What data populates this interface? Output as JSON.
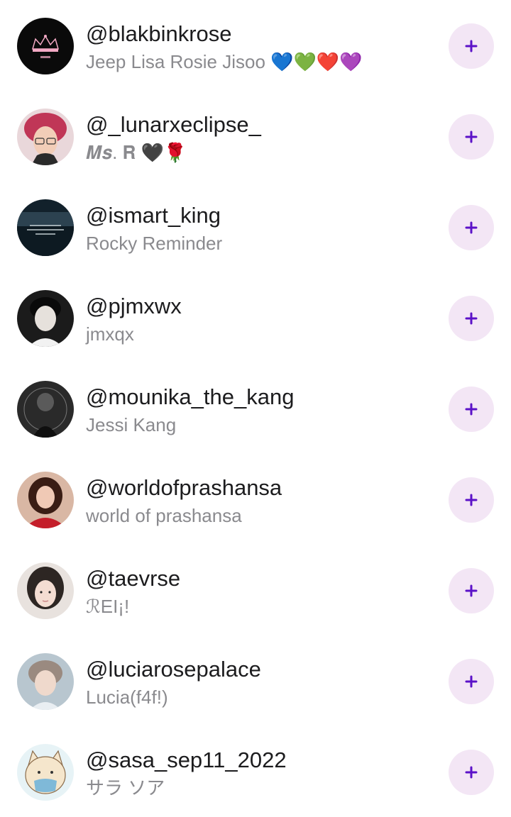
{
  "follow_icon": "plus-icon",
  "colors": {
    "accent": "#5b12c8",
    "follow_bg": "#f3e6f5",
    "handle": "#1c1c1e",
    "bio": "#8a8a8e"
  },
  "suggestions": [
    {
      "handle": "@blakbinkrose",
      "bio": "Jeep Lisa Rosie Jisoo 💙💚❤️💜"
    },
    {
      "handle": "@_lunarxeclipse_",
      "bio": "𝑴𝒔. 𝐑 🖤🌹"
    },
    {
      "handle": "@ismart_king",
      "bio": "Rocky Reminder"
    },
    {
      "handle": "@pjmxwx",
      "bio": "jmxqx"
    },
    {
      "handle": "@mounika_the_kang",
      "bio": "Jessi Kang"
    },
    {
      "handle": "@worldofprashansa",
      "bio": "world of prashansa"
    },
    {
      "handle": "@taevrse",
      "bio": "ℛEI¡!"
    },
    {
      "handle": "@luciarosepalace",
      "bio": "Lucia(f4f!)"
    },
    {
      "handle": "@sasa_sep11_2022",
      "bio": "サラ ソア"
    }
  ]
}
